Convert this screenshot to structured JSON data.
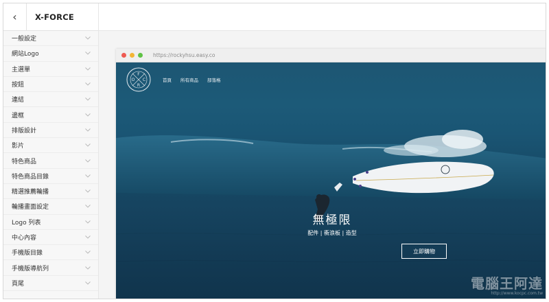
{
  "sidebar": {
    "back_label": "‹",
    "title": "X-FORCE",
    "items": [
      {
        "label": "一般設定"
      },
      {
        "label": "網站Logo"
      },
      {
        "label": "主選單"
      },
      {
        "label": "按鈕"
      },
      {
        "label": "連結"
      },
      {
        "label": "邊框"
      },
      {
        "label": "排版設計"
      },
      {
        "label": "影片"
      },
      {
        "label": "特色商品"
      },
      {
        "label": "特色商品目錄"
      },
      {
        "label": "精選推薦輪播"
      },
      {
        "label": "輪播畫面設定"
      },
      {
        "label": "Logo 列表"
      },
      {
        "label": "中心內容"
      },
      {
        "label": "手機版目錄"
      },
      {
        "label": "手機版導航列"
      },
      {
        "label": "頁尾"
      }
    ]
  },
  "browser": {
    "url": "https://rockyhsu.easy.co",
    "dots": [
      "#ee5a52",
      "#f3b535",
      "#5fc245"
    ]
  },
  "site": {
    "logo_letters": [
      "F",
      "O",
      "C",
      "R"
    ],
    "nav": [
      "首頁",
      "所有商品",
      "部落格"
    ],
    "hero_title": "無極限",
    "hero_subtitle": "配件 | 衝浪板 | 造型",
    "cta_label": "立即購物"
  },
  "watermark": {
    "text": "電腦王阿達",
    "url": "http://www.kocpc.com.tw"
  },
  "colors": {
    "sea_top": "#1d5673",
    "sea_bottom": "#10344c",
    "surfboard": "#f1f3f5"
  }
}
